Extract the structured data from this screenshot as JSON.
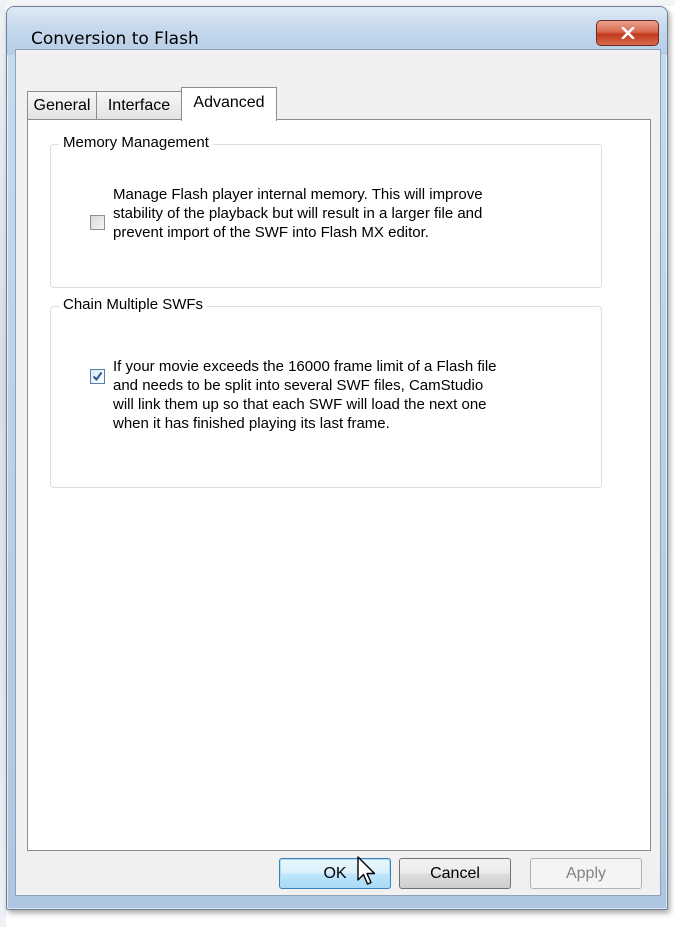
{
  "window": {
    "title": "Conversion to Flash",
    "close_label": "x"
  },
  "tabs": [
    {
      "label": "General",
      "active": false
    },
    {
      "label": "Interface",
      "active": false
    },
    {
      "label": "Advanced",
      "active": true
    }
  ],
  "memory_group": {
    "legend": "Memory Management",
    "checked": false,
    "lines": [
      "Manage Flash player internal memory. This will improve",
      "stability of the playback but will result in a larger file and",
      "prevent import of the SWF into Flash MX editor."
    ]
  },
  "chain_group": {
    "legend": "Chain Multiple SWFs",
    "checked": true,
    "lines": [
      "If your movie exceeds the 16000 frame limit of a Flash file",
      "and needs to be split into several SWF files, CamStudio",
      "will link them up so that each SWF will load the next one",
      "when it has finished playing its last frame."
    ]
  },
  "buttons": {
    "ok": "OK",
    "cancel": "Cancel",
    "apply": "Apply"
  },
  "icons": {
    "close": "close-icon",
    "check": "checkmark-icon",
    "cursor": "mouse-pointer-icon"
  }
}
